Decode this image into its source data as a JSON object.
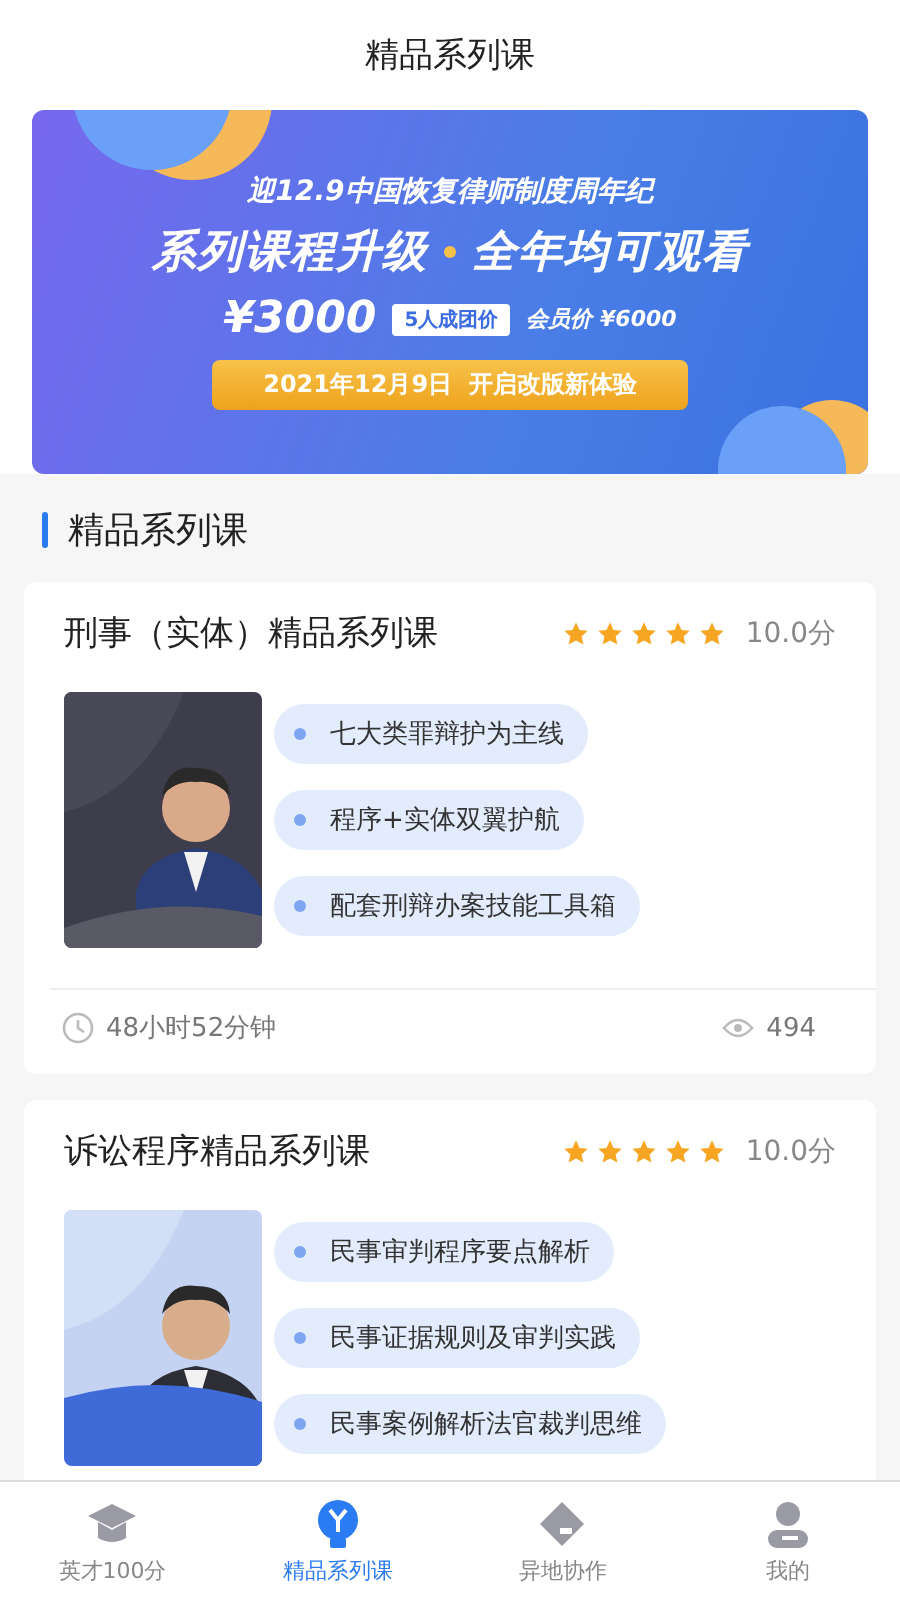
{
  "header": {
    "title": "精品系列课"
  },
  "banner": {
    "headline": "迎12.9中国恢复律师制度周年纪",
    "slogan_left": "系列课程升级",
    "slogan_right": "全年均可观看",
    "price": "¥3000",
    "group_badge": "5人成团价",
    "member_price": "会员价 ¥6000",
    "date_bar": "2021年12月9日  开启改版新体验"
  },
  "section": {
    "title": "精品系列课"
  },
  "courses": [
    {
      "title": "刑事（实体）精品系列课",
      "stars": 5,
      "score": "10.0分",
      "cover": {
        "kind": "picture"
      },
      "points": [
        "七大类罪辩护为主线",
        "程序+实体双翼护航",
        "配套刑辩办案技能工具箱"
      ],
      "duration": "48小时52分钟",
      "views": "494"
    },
    {
      "title": "诉讼程序精品系列课",
      "stars": 5,
      "score": "10.0分",
      "cover": {
        "kind": "picture"
      },
      "points": [
        "民事审判程序要点解析",
        "民事证据规则及审判实践",
        "民事案例解析法官裁判思维"
      ]
    }
  ],
  "tabs": [
    {
      "label": "英才100分",
      "selected": false
    },
    {
      "label": "精品系列课",
      "selected": true
    },
    {
      "label": "异地协作",
      "selected": false
    },
    {
      "label": "我的",
      "selected": false
    }
  ]
}
